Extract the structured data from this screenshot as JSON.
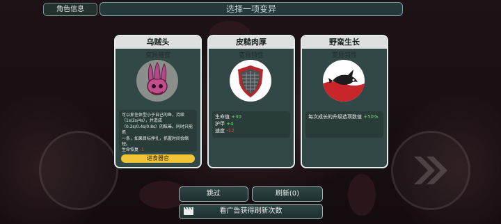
{
  "header": {
    "info_button": "角色信息",
    "title": "选择一项变异"
  },
  "cards": [
    {
      "title": "乌贼头",
      "subtitle": "变异器官",
      "desc_lines": [
        "可以抓住体型小于自己的鱼，持续",
        "（1s/2s/4s），并造成",
        "（0.2s/0.4s/0.8s）的眩晕。同时只能抓",
        "一条，如果目标挣扎，抓握时间会缩",
        "短。"
      ],
      "stat_label": "生命恢复",
      "stat_value": "-1",
      "button": "进食器官"
    },
    {
      "title": "皮糙肉厚",
      "subtitle": "变异特性",
      "stats": [
        {
          "label": "生命值",
          "value": "+30",
          "color": "green"
        },
        {
          "label": "护甲",
          "value": "+4",
          "color": "green"
        },
        {
          "label": "速度",
          "value": "-12",
          "color": "red"
        }
      ]
    },
    {
      "title": "野蛮生长",
      "subtitle": "变异特性",
      "desc_label": "每次成长的升级选项数值",
      "desc_value": "+50%"
    }
  ],
  "actions": {
    "skip": "跳过",
    "refresh": "刷新(0)",
    "ad": "看广告获得刷新次数"
  },
  "colors": {
    "accent_yellow": "#f0c437",
    "positive": "#5ce06a",
    "negative": "#e64a3a"
  }
}
